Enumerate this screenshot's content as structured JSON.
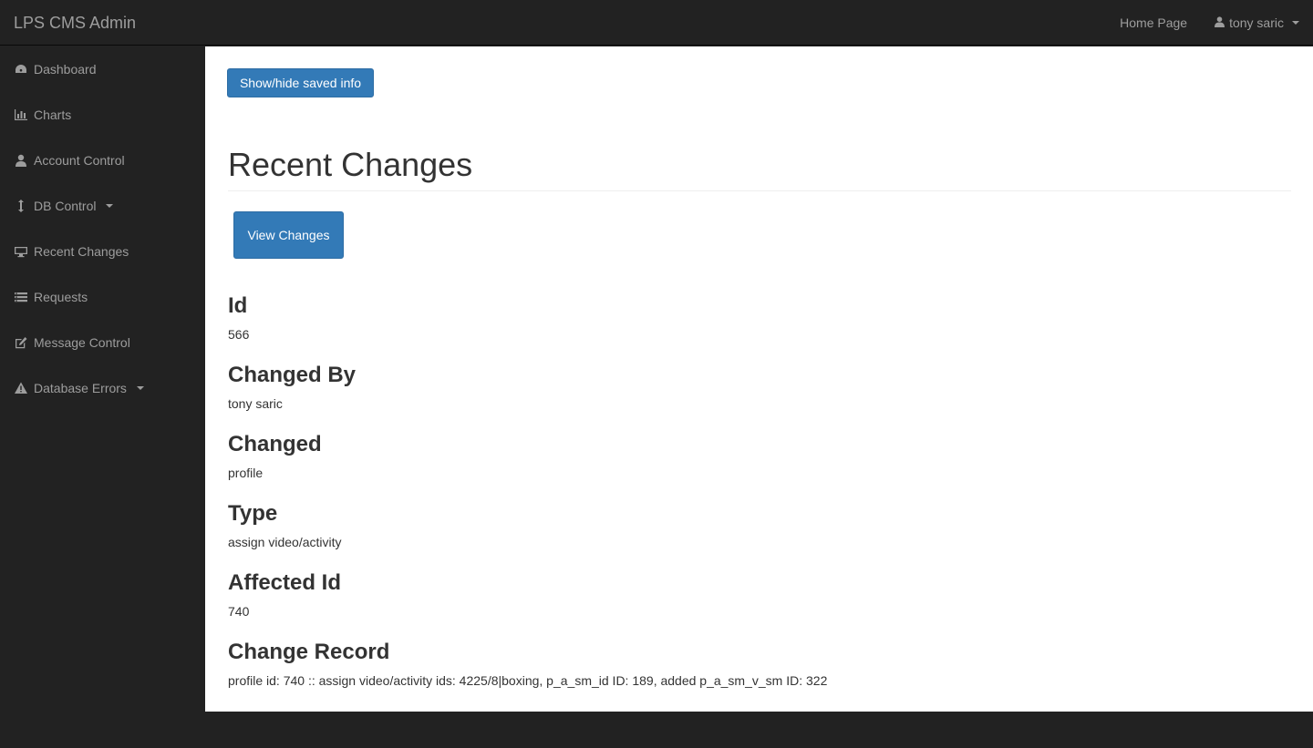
{
  "app": {
    "brand": "LPS CMS Admin"
  },
  "topnav": {
    "home_link": "Home Page",
    "user_menu": "tony saric"
  },
  "sidebar": {
    "items": [
      {
        "label": "Dashboard",
        "icon": "dashboard-icon"
      },
      {
        "label": "Charts",
        "icon": "bar-chart-icon"
      },
      {
        "label": "Account Control",
        "icon": "user-icon"
      },
      {
        "label": "DB Control",
        "icon": "arrows-vertical-icon",
        "dropdown": true
      },
      {
        "label": "Recent Changes",
        "icon": "desktop-icon"
      },
      {
        "label": "Requests",
        "icon": "list-icon"
      },
      {
        "label": "Message Control",
        "icon": "edit-icon"
      },
      {
        "label": "Database Errors",
        "icon": "warning-icon",
        "dropdown": true
      }
    ]
  },
  "main": {
    "toggle_button": "Show/hide saved info",
    "page_title": "Recent Changes",
    "view_button": "View Changes",
    "fields": [
      {
        "label": "Id",
        "value": "566"
      },
      {
        "label": "Changed By",
        "value": "tony saric"
      },
      {
        "label": "Changed",
        "value": "profile"
      },
      {
        "label": "Type",
        "value": "assign video/activity"
      },
      {
        "label": "Affected Id",
        "value": "740"
      },
      {
        "label": "Change Record",
        "value": "profile id: 740 :: assign video/activity ids: 4225/8|boxing, p_a_sm_id ID: 189, added p_a_sm_v_sm ID: 322"
      }
    ]
  },
  "colors": {
    "navbar_bg": "#222222",
    "nav_text": "#9d9d9d",
    "primary": "#337ab7"
  }
}
